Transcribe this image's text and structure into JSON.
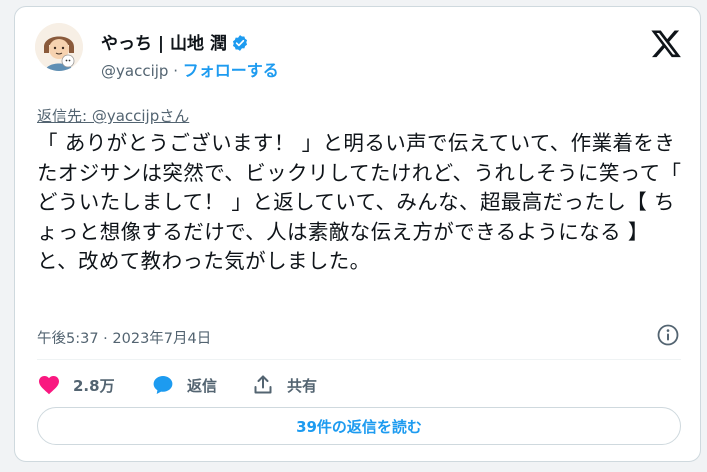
{
  "author": {
    "name": "やっち | 山地 潤",
    "handle": "@yaccijp",
    "separator": "·",
    "follow_label": "フォローする"
  },
  "reply_to": "返信先: @yaccijpさん",
  "tweet_text": "「 ありがとうございます！ 」と明るい声で伝えていて、作業着をきたオジサンは突然で、ビックリしてたけれど、うれしそうに笑って「 どういたしまして！ 」と返していて、みんな、超最高だったし【 ちょっと想像するだけで、人は素敵な伝え方ができるようになる 】と、改めて教わった気がしました。",
  "timestamp": "午後5:37 · 2023年7月4日",
  "actions": {
    "like_count": "2.8万",
    "reply_label": "返信",
    "share_label": "共有"
  },
  "read_replies_label": "39件の返信を読む",
  "colors": {
    "accent": "#1d9bf0",
    "like": "#f91880",
    "text": "#0f1419",
    "muted": "#536471"
  },
  "icons": [
    "verified-badge-icon",
    "x-logo-icon",
    "info-icon",
    "heart-icon",
    "reply-bubble-icon",
    "share-icon"
  ]
}
